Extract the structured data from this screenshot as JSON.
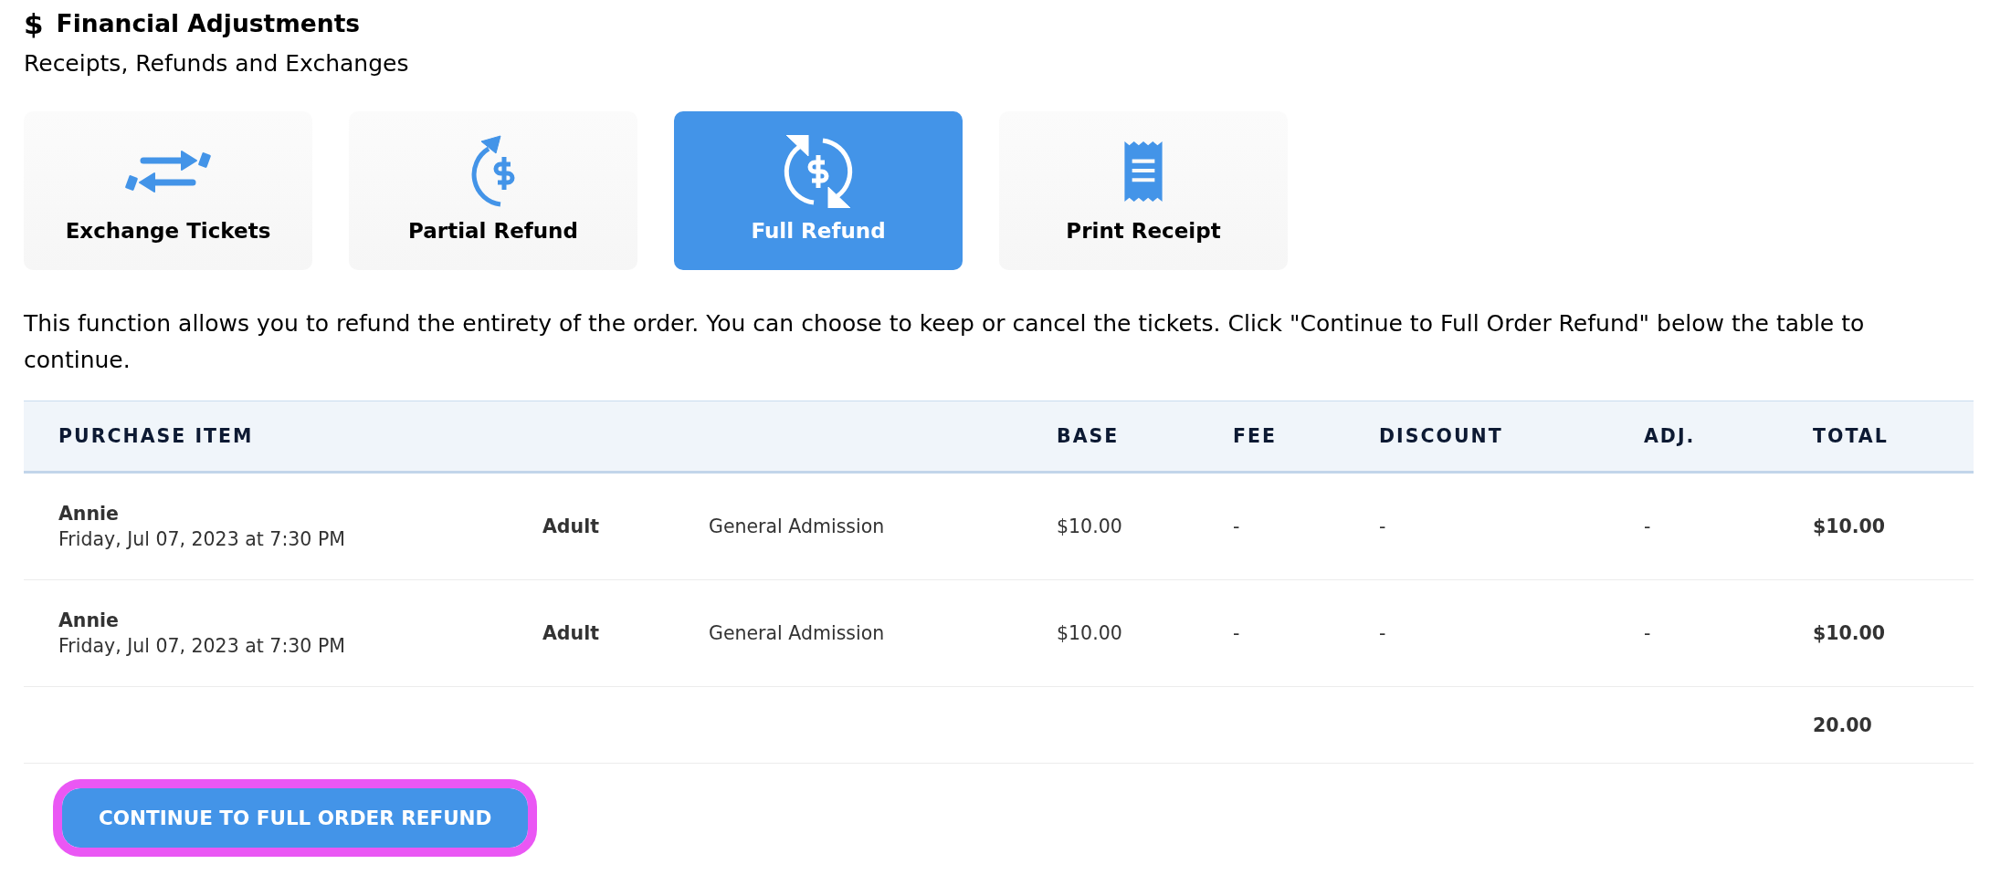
{
  "header": {
    "icon": "$",
    "title": "Financial Adjustments",
    "subtitle": "Receipts, Refunds and Exchanges"
  },
  "tabs": [
    {
      "label": "Exchange Tickets",
      "kind": "exchange",
      "selected": false
    },
    {
      "label": "Partial Refund",
      "kind": "partial_refund",
      "selected": false
    },
    {
      "label": "Full Refund",
      "kind": "full_refund",
      "selected": true
    },
    {
      "label": "Print Receipt",
      "kind": "receipt",
      "selected": false
    }
  ],
  "description": "This function allows you to refund the entirety of the order. You can choose to keep or cancel the tickets. Click \"Continue to Full Order Refund\" below the table to continue.",
  "table": {
    "columns": [
      "PURCHASE ITEM",
      "BASE",
      "FEE",
      "DISCOUNT",
      "ADJ.",
      "TOTAL"
    ],
    "rows": [
      {
        "purchase_item": "Annie",
        "date": "Friday, Jul 07, 2023 at 7:30 PM",
        "column_2": "Adult",
        "column_3": "General Admission",
        "base": "$10.00",
        "fee": "-",
        "discount": "-",
        "adj": "-",
        "total": "$10.00"
      },
      {
        "purchase_item": "Annie",
        "date": "Friday, Jul 07, 2023 at 7:30 PM",
        "column_2": "Adult",
        "column_3": "General Admission",
        "base": "$10.00",
        "fee": "-",
        "discount": "-",
        "adj": "-",
        "total": "$10.00"
      }
    ],
    "grand_total": "20.00"
  },
  "button": {
    "label": "CONTINUE TO FULL ORDER REFUND",
    "focused": true
  }
}
